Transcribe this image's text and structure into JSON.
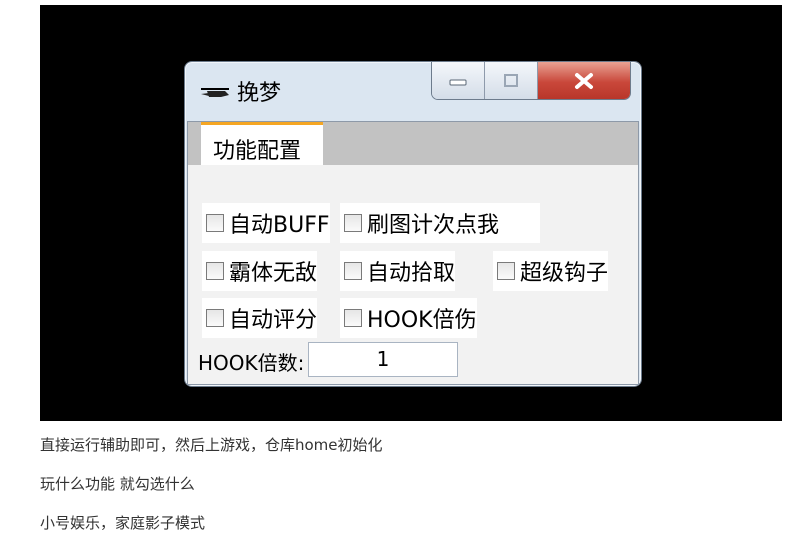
{
  "window": {
    "title": "挽梦",
    "tab": "功能配置"
  },
  "options": [
    {
      "label": "自动BUFF",
      "checked": false
    },
    {
      "label": "刷图计次点我",
      "checked": false
    },
    {
      "label": "霸体无敌",
      "checked": false
    },
    {
      "label": "自动拾取",
      "checked": false
    },
    {
      "label": "超级钩子",
      "checked": false
    },
    {
      "label": "自动评分",
      "checked": false
    },
    {
      "label": "HOOK倍伤",
      "checked": false
    }
  ],
  "hook_multiplier": {
    "label": "HOOK倍数:",
    "value": "1"
  },
  "paragraphs": [
    "直接运行辅助即可，然后上游戏，仓库home初始化",
    "玩什么功能 就勾选什么",
    "小号娱乐，家庭影子模式"
  ]
}
